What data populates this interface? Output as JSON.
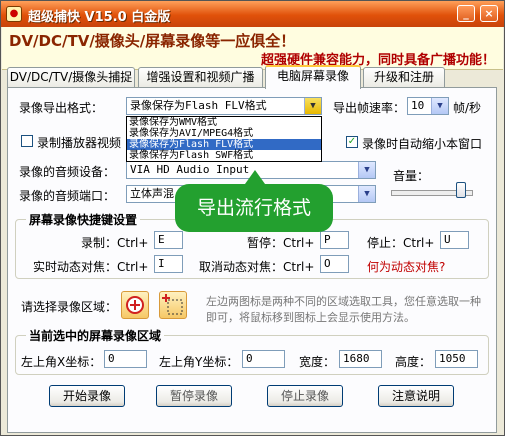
{
  "window": {
    "title": "超级捕快 V15.0 白金版",
    "minimize_glyph": "_",
    "close_glyph": "×"
  },
  "banner": {
    "line1": "DV/DC/TV/摄像头/屏幕录像等一应俱全！",
    "line2": "超强硬件兼容能力，同时具备广播功能！"
  },
  "tabs": [
    {
      "label": "DV/DC/TV/摄像头捕捉"
    },
    {
      "label": "增强设置和视频广播"
    },
    {
      "label": "电脑屏幕录像"
    },
    {
      "label": "升级和注册"
    }
  ],
  "export": {
    "label": "录像导出格式：",
    "selected": "录像保存为Flash FLV格式",
    "options": [
      "录像保存为WMV格式",
      "录像保存为AVI/MPEG4格式",
      "录像保存为Flash FLV格式",
      "录像保存为Flash SWF格式"
    ],
    "selected_index": 2,
    "fps_label": "导出帧速率：",
    "fps_value": "10",
    "fps_unit": "帧/秒"
  },
  "options": {
    "record_player_label": "录制播放器视频",
    "record_player_checked": false,
    "auto_minimize_label": "录像时自动缩小本窗口",
    "auto_minimize_checked": true
  },
  "audio": {
    "device_label": "录像的音频设备：",
    "device_value": "VIA HD Audio Input",
    "port_label": "录像的音频端口：",
    "port_value": "立体声混",
    "volume_label": "音量：",
    "volume_level": 0.88
  },
  "tooltip": "导出流行格式",
  "hotkeys": {
    "title": "屏幕录像快捷键设置",
    "record_label": "录制：Ctrl+",
    "record_value": "E",
    "pause_label": "暂停：Ctrl+",
    "pause_value": "P",
    "stop_label": "停止：Ctrl+",
    "stop_value": "U",
    "live_label": "实时动态对焦：Ctrl+",
    "live_value": "I",
    "cancel_label": "取消动态对焦：Ctrl+",
    "cancel_value": "O",
    "help_link": "何为动态对焦?"
  },
  "region": {
    "label": "请选择录像区域：",
    "hint": "左边两图标是两种不同的区域选取工具，您任意选取一种即可，将鼠标移到图标上会显示使用方法。"
  },
  "current": {
    "title": "当前选中的屏幕录像区域",
    "x_label": "左上角X坐标：",
    "x_value": "0",
    "y_label": "左上角Y坐标：",
    "y_value": "0",
    "w_label": "宽度：",
    "w_value": "1680",
    "h_label": "高度：",
    "h_value": "1050"
  },
  "buttons": {
    "start": "开始录像",
    "pause": "暂停录像",
    "stop": "停止录像",
    "notes": "注意说明"
  }
}
